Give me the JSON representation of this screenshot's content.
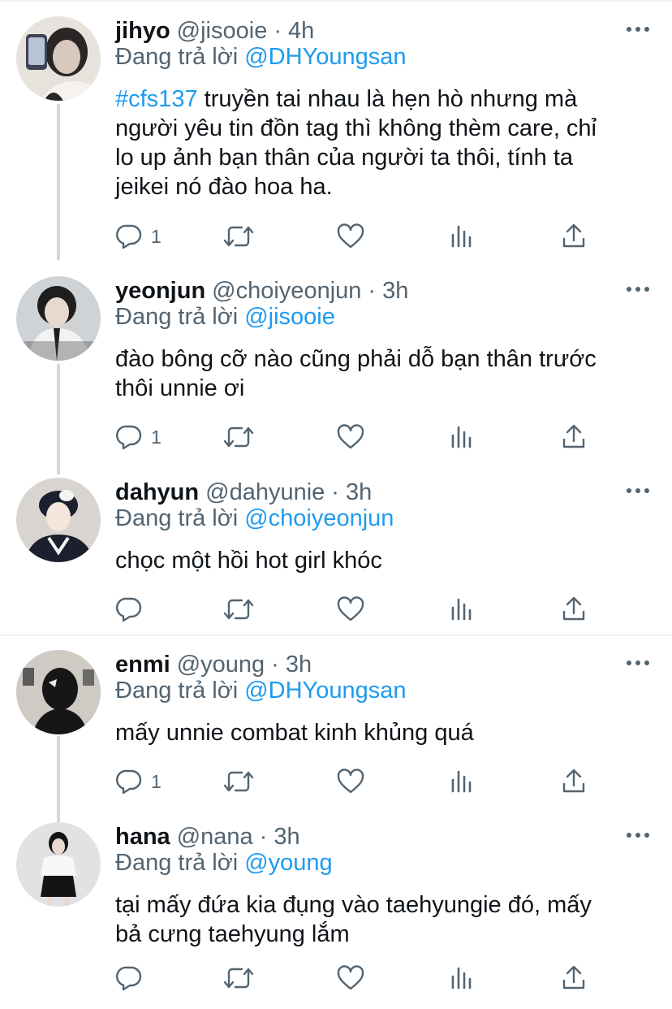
{
  "tweets": [
    {
      "name": "jihyo",
      "handle": "@jisooie",
      "dot": "·",
      "time": "4h",
      "reply_prefix": "Đang trả lời",
      "reply_mention": "@DHYoungsan",
      "hashtag": "#cfs137",
      "lines": [
        " truyền tai nhau là hẹn hò nhưng mà",
        "người yêu tin đồn tag thì không thèm care, chỉ",
        "lo up ảnh bạn thân của người ta thôi, tính ta",
        "jeikei nó đào hoa ha."
      ],
      "reply_count": "1",
      "avatar_colors": [
        "#e8e2dc",
        "#2b2626",
        "#d9c8bd"
      ]
    },
    {
      "name": "yeonjun",
      "handle": "@choiyeonjun",
      "dot": "·",
      "time": "3h",
      "reply_prefix": "Đang trả lời",
      "reply_mention": "@jisooie",
      "lines": [
        "đào bông cỡ nào cũng phải dỗ bạn thân trước",
        "thôi unnie ơi"
      ],
      "reply_count": "1",
      "avatar_colors": [
        "#cfd3d6",
        "#1e1e1e",
        "#f2f2f2"
      ]
    },
    {
      "name": "dahyun",
      "handle": "@dahyunie",
      "dot": "·",
      "time": "3h",
      "reply_prefix": "Đang trả lời",
      "reply_mention": "@choiyeonjun",
      "lines": [
        "chọc một hồi hot girl khóc"
      ],
      "reply_count": "",
      "avatar_colors": [
        "#d8d4cf",
        "#1b1f2e",
        "#f4e6dc"
      ]
    },
    {
      "name": "enmi",
      "handle": "@young",
      "dot": "·",
      "time": "3h",
      "reply_prefix": "Đang trả lời",
      "reply_mention": "@DHYoungsan",
      "lines": [
        "mấy unnie combat kinh khủng quá"
      ],
      "reply_count": "1",
      "avatar_colors": [
        "#cfcac4",
        "#161616",
        "#efe9e2"
      ]
    },
    {
      "name": "hana",
      "handle": "@nana",
      "dot": "·",
      "time": "3h",
      "reply_prefix": "Đang trả lời",
      "reply_mention": "@young",
      "lines": [
        "tại mấy đứa kia đụng vào taehyungie đó, mấy",
        "bả cưng taehyung lắm"
      ],
      "reply_count": "",
      "avatar_colors": [
        "#e2e2e4",
        "#141414",
        "#f7f7f7"
      ]
    }
  ],
  "colors": {
    "link": "#1d9bf0",
    "secondary_text": "#536471",
    "primary_text": "#0f1419",
    "thread_line": "#cfd9de",
    "separator": "#eff3f4"
  },
  "icons": [
    "reply-icon",
    "retweet-icon",
    "like-icon",
    "views-icon",
    "share-icon",
    "more-icon"
  ]
}
